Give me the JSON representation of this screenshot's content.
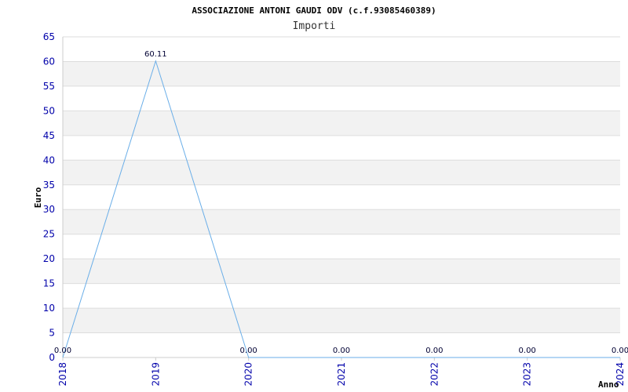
{
  "chart_data": {
    "type": "line",
    "title": "ASSOCIAZIONE ANTONI GAUDI ODV (c.f.93085460389)",
    "subtitle": "Importi",
    "xlabel": "Anno",
    "ylabel": "Euro",
    "x": [
      "2018",
      "2019",
      "2020",
      "2021",
      "2022",
      "2023",
      "2024"
    ],
    "y": [
      0,
      60.11,
      0,
      0,
      0,
      0,
      0
    ],
    "data_labels": [
      "0.00",
      "60.11",
      "0.00",
      "0.00",
      "0.00",
      "0.00",
      "0.00"
    ],
    "label_shown": [
      true,
      true,
      true,
      true,
      true,
      true,
      true
    ],
    "yticks": [
      "0",
      "5",
      "10",
      "15",
      "20",
      "25",
      "30",
      "35",
      "40",
      "45",
      "50",
      "55",
      "60",
      "65"
    ],
    "ylim": [
      0,
      65
    ],
    "grid": true,
    "colors": {
      "line": "#6aaee8",
      "band": "#f2f2f2",
      "tick": "#0000aa",
      "gridline": "#dddddd",
      "axis": "#cccccc"
    }
  }
}
